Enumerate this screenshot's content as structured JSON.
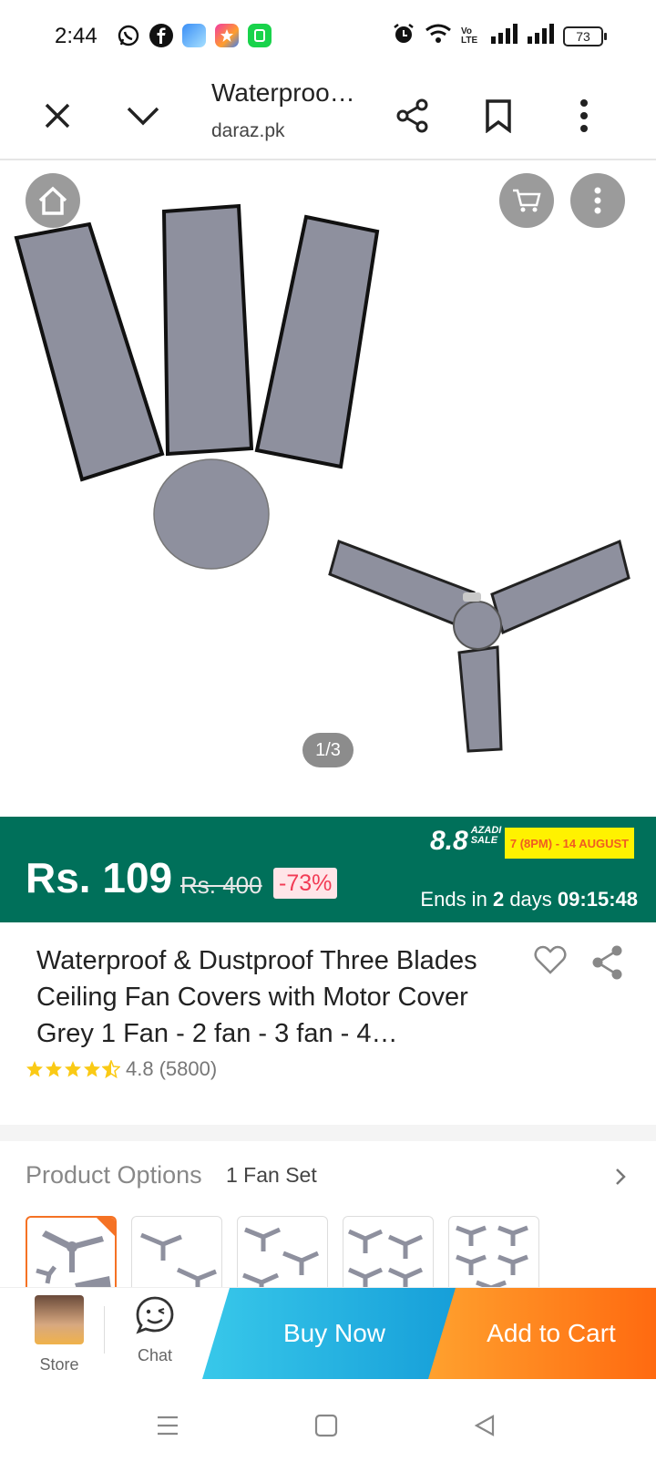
{
  "status_bar": {
    "time": "2:44",
    "battery": "73",
    "network_label": "Vo LTE"
  },
  "browser": {
    "title": "Waterproo…",
    "url": "daraz.pk"
  },
  "hero": {
    "pager": "1/3"
  },
  "price_banner": {
    "price": "Rs. 109",
    "old_price": "Rs. 400",
    "discount": "-73%",
    "sale_logo_number": "8.8",
    "sale_logo_text_1": "AZADI",
    "sale_logo_text_2": "SALE",
    "sale_dates": "7 (8PM) - 14 AUGUST",
    "ends_prefix": "Ends in",
    "ends_days": "2",
    "ends_days_label": "days",
    "ends_timer": "09:15:48",
    "colors": {
      "banner": "#00705a",
      "discount_text": "#f23b55"
    }
  },
  "product": {
    "title": "Waterproof & Dustproof Three Blades Ceiling Fan Covers with Motor Cover Grey 1 Fan - 2 fan - 3 fan - 4…",
    "rating": "4.8",
    "reviews": "(5800)"
  },
  "options": {
    "label": "Product Options",
    "selected": "1 Fan Set"
  },
  "action_bar": {
    "store_label": "Store",
    "chat_label": "Chat",
    "buy_now": "Buy Now",
    "add_to_cart": "Add to Cart"
  }
}
